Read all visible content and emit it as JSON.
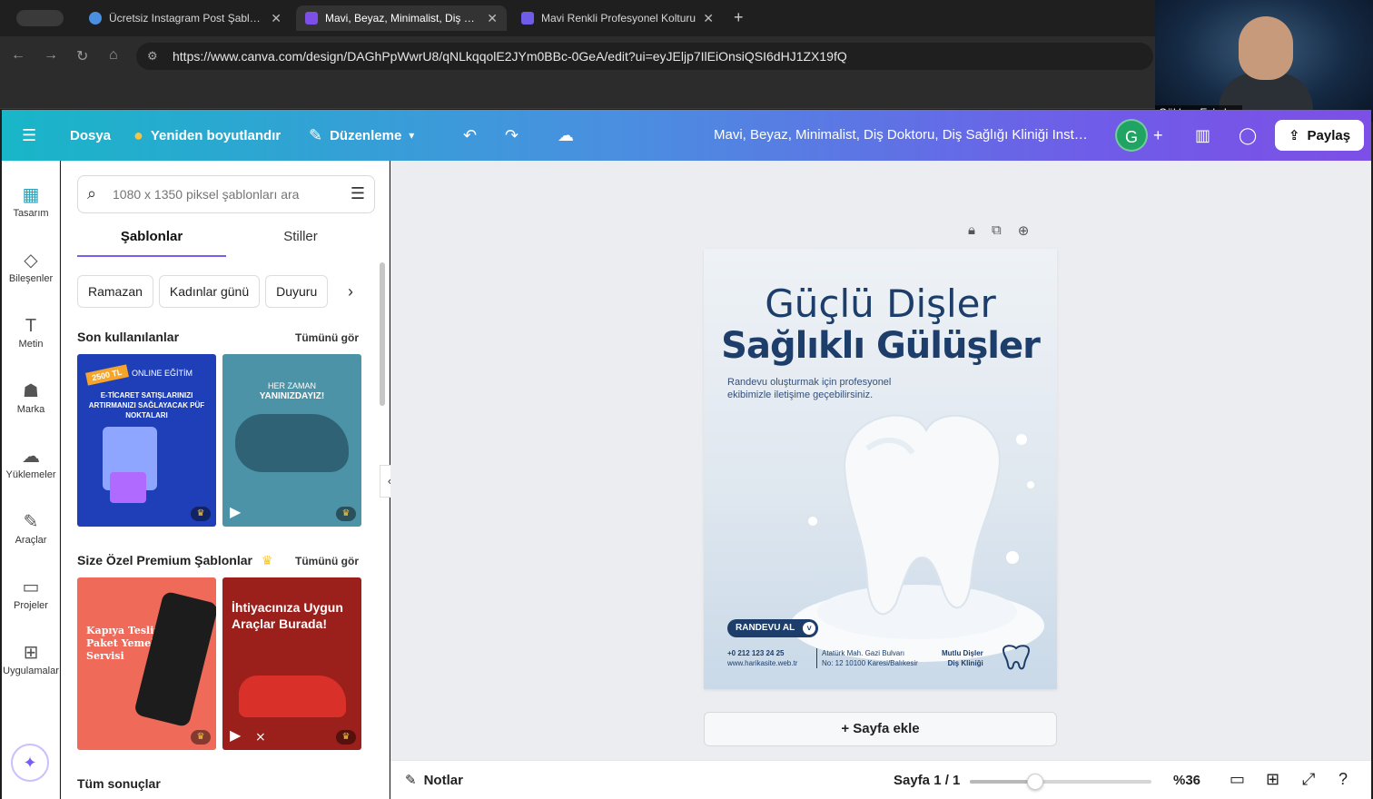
{
  "browser": {
    "tabs": [
      {
        "title": "Ücretsiz Instagram Post Şablonları",
        "favicon_color": "#4a8fe0",
        "close": "✕"
      },
      {
        "title": "Mavi, Beyaz, Minimalist, Diş Doktoru",
        "favicon_color": "#7d4fe6",
        "close": "✕"
      },
      {
        "title": "Mavi Renkli Profesyonel Kolturu",
        "favicon_color": "#6f5ce8",
        "close": "✕"
      }
    ],
    "new_tab": "+",
    "url": "https://www.canva.com/design/DAGhPpWwrU8/qNLkqqolE2JYm0BBc-0GeA/edit?ui=eyJEljp7IlEiOnsiQSI6dHJ1ZX19fQ"
  },
  "webcam": {
    "name": "Gökhan Eskalen"
  },
  "toolbar": {
    "menu_icon": "☰",
    "file": "Dosya",
    "resize": "Yeniden boyutlandır",
    "edit": "Düzenleme",
    "doc_title": "Mavi, Beyaz, Minimalist, Diş Doktoru, Diş Sağlığı Kliniği Instagram Gönderisi",
    "avatar": "G",
    "share": "Paylaş"
  },
  "rail": {
    "items": [
      {
        "label": "Tasarım",
        "icon": "▦"
      },
      {
        "label": "Bileşenler",
        "icon": "◇"
      },
      {
        "label": "Metin",
        "icon": "T"
      },
      {
        "label": "Marka",
        "icon": "☗"
      },
      {
        "label": "Yüklemeler",
        "icon": "☁"
      },
      {
        "label": "Araçlar",
        "icon": "✎"
      },
      {
        "label": "Projeler",
        "icon": "▭"
      },
      {
        "label": "Uygulamalar",
        "icon": "⊞"
      }
    ],
    "magic": "✦"
  },
  "panel": {
    "search": {
      "placeholder": "1080 x 1350 piksel şablonları ara"
    },
    "tabs": [
      "Şablonlar",
      "Stiller"
    ],
    "chips": [
      "Ramazan",
      "Kadınlar günü",
      "Duyuru"
    ],
    "recent": {
      "title": "Son kullanılanlar",
      "see_all": "Tümünü gör",
      "items": [
        {
          "bg": "#1f3fb8",
          "badge": "2500 TL",
          "tag": "ONLINE EĞİTİM",
          "text": "E-TİCARET SATIŞLARINIZI ARTIRMANIZI SAĞLAYACAK PÜF NOKTALARI"
        },
        {
          "bg": "#4d93a8",
          "tag": "HER ZAMAN",
          "text": "YANINIZDAYIZ!"
        }
      ]
    },
    "premium": {
      "title": "Size Özel Premium Şablonlar",
      "see_all": "Tümünü gör",
      "items": [
        {
          "bg": "#f06a5a",
          "text": "Kapıya Teslim Paket Yemek Servisi"
        },
        {
          "bg": "#9b1f1a",
          "text": "İhtiyacınıza Uygun Araçlar Burada!"
        }
      ]
    },
    "all_results": "Tüm sonuçlar"
  },
  "design": {
    "headline1": "Güçlü Dişler",
    "headline2": "Sağlıklı Gülüşler",
    "subtitle": "Randevu oluşturmak için profesyonel ekibimizle iletişime geçebilirsiniz.",
    "cta": "RANDEVU AL",
    "phone": "+0 212 123 24 25",
    "website": "www.harikasite.web.tr",
    "address1": "Atatürk Mah. Gazi Bulvarı",
    "address2": "No: 12 10100 Karesi/Balıkesir",
    "clinic1": "Mutlu Dişler",
    "clinic2": "Diş Kliniği"
  },
  "canvas": {
    "add_page": "+ Sayfa ekle"
  },
  "bottom": {
    "notes": "Notlar",
    "page_indicator": "Sayfa 1 / 1",
    "zoom": "%36",
    "zoom_slider_fraction": 0.36
  }
}
